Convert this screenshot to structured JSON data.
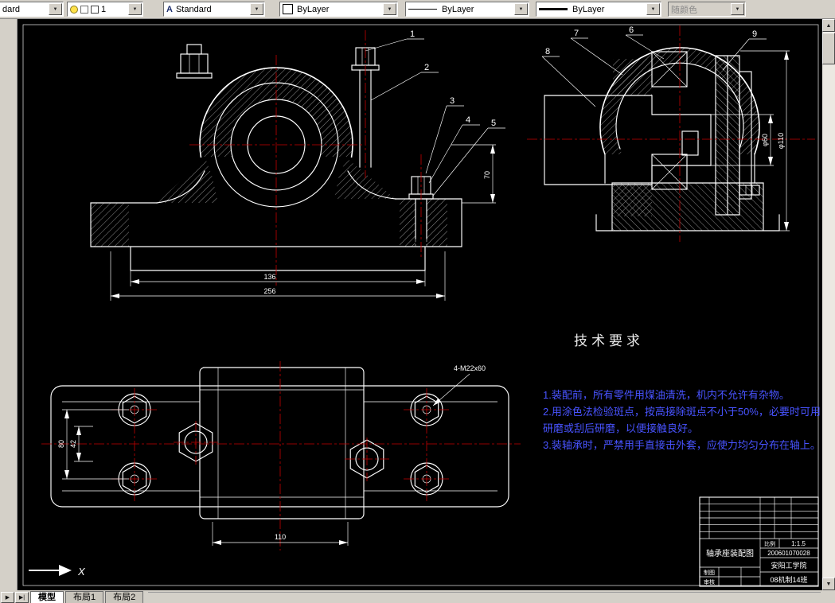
{
  "colors": {
    "chrome": "#d4d0c8",
    "canvas_bg": "#000000",
    "object_line": "#ffffff",
    "centerline": "#c40000",
    "notes_text": "#4853ff"
  },
  "toolbar": {
    "style_partial": {
      "value": "dard"
    },
    "layer": {
      "value": "1"
    },
    "text_style": {
      "value": "Standard"
    },
    "color": {
      "value": "ByLayer"
    },
    "linetype": {
      "value": "ByLayer"
    },
    "lineweight": {
      "value": "ByLayer"
    },
    "plot_style": {
      "value": "随颜色"
    }
  },
  "drawing": {
    "balloons": [
      "1",
      "2",
      "3",
      "4",
      "5",
      "6",
      "7",
      "8",
      "9"
    ],
    "tech_requirements": {
      "title": "技术要求",
      "lines": [
        "1.装配前，所有零件用煤油清洗，机内不允许有杂物。",
        "2.用涂色法检验斑点，按高接除斑点不小于50%，必要时可用",
        "研磨或刮后研磨，以便接触良好。",
        "3.装轴承时，严禁用手直接击外套，应使力均匀分布在轴上。"
      ]
    },
    "dims": {
      "front_bolt_span": "136",
      "front_base_width": "256",
      "front_height": "70",
      "top_length": "110",
      "top_outer": "80",
      "top_inner": "42",
      "bolt_callout": "4-M22x60",
      "side_dia_outer": "φ110",
      "side_dia_inner": "φ60"
    },
    "ucs_x_label": "X"
  },
  "title_block": {
    "drawing_name": "轴承座装配图",
    "scale_label": "比例",
    "scale_value": "1:1.5",
    "drawing_number": "200601070028",
    "school": "安阳工学院",
    "class_name": "08机制14班",
    "drafter_label": "制图",
    "checker_label": "审核"
  },
  "tabs": {
    "model": "模型",
    "layout1": "布局1",
    "layout2": "布局2"
  }
}
